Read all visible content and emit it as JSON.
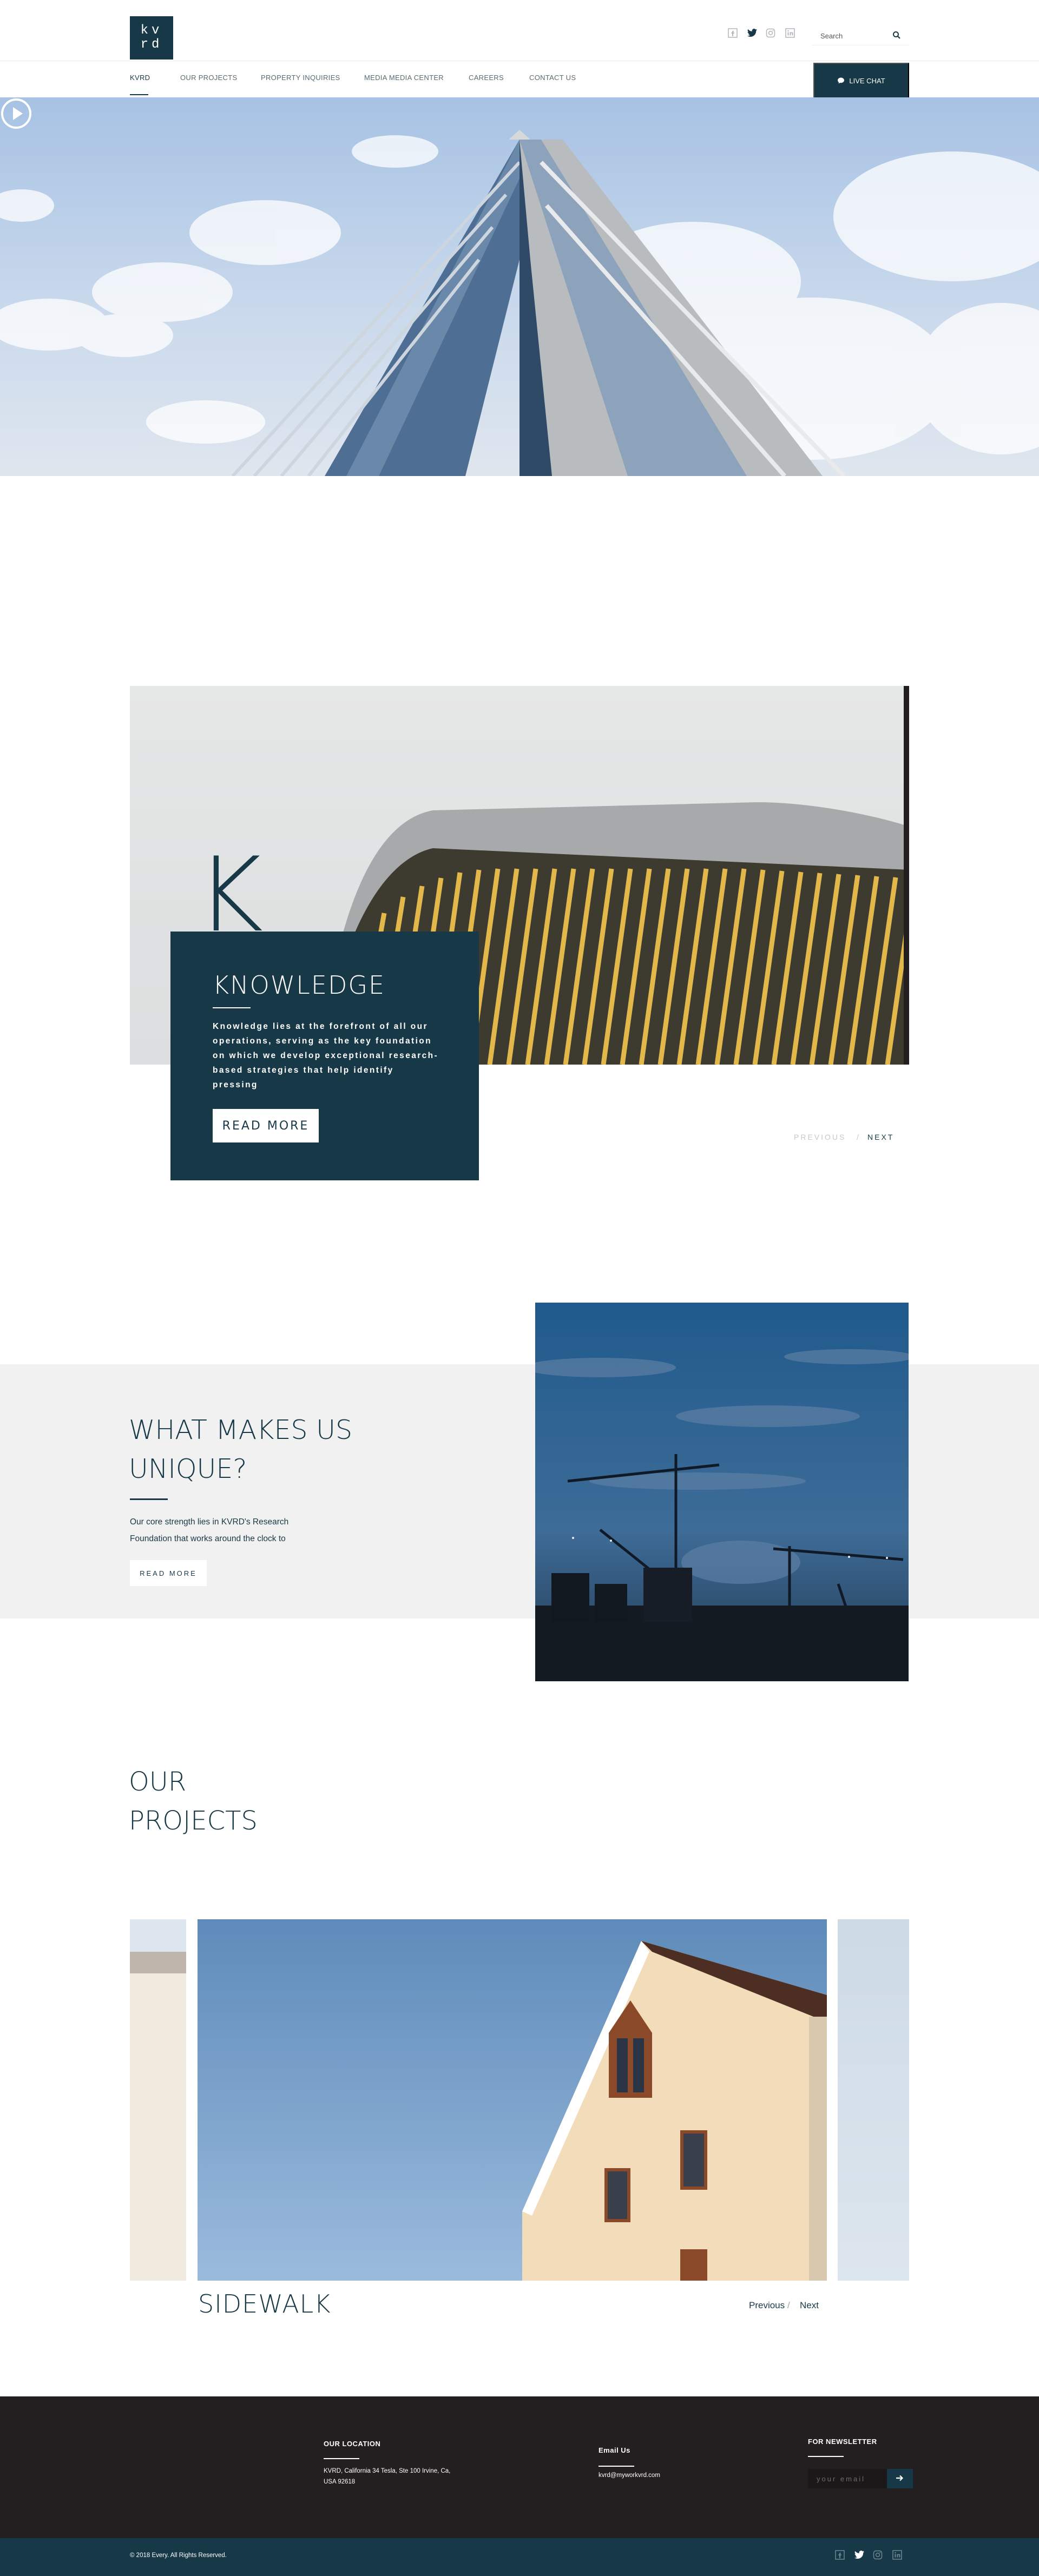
{
  "header": {
    "logo": {
      "line1": "kv",
      "line2": "rd"
    },
    "social": [
      "facebook-icon",
      "twitter-icon",
      "instagram-icon",
      "linkedin-icon"
    ],
    "search": {
      "placeholder": "Search"
    },
    "nav": [
      {
        "label": "KVRD",
        "active": true
      },
      {
        "label": "OUR PROJECTS",
        "active": false
      },
      {
        "label": "PROPERTY INQUIRIES",
        "active": false
      },
      {
        "label": "MEDIA MEDIA CENTER",
        "active": false
      },
      {
        "label": "CAREERS",
        "active": false
      },
      {
        "label": "CONTACT US",
        "active": false
      }
    ],
    "live_chat": "LIVE CHAT"
  },
  "hero": {
    "play_icon": "play-icon"
  },
  "knowledge": {
    "letter": "K",
    "title": "KNOWLEDGE",
    "body": "Knowledge lies at the forefront of all our operations, serving as the key foundation on which we develop exceptional research-based strategies that help identify pressing",
    "button": "READ MORE",
    "prev": "PREVIOUS",
    "separator": "/",
    "next": "NEXT"
  },
  "unique": {
    "title": "WHAT MAKES US UNIQUE?",
    "body": "Our core strength lies in KVRD's Research Foundation that works around the clock to",
    "button": "READ MORE"
  },
  "projects": {
    "title": "OUR PROJECTS",
    "current_name": "SIDEWALK",
    "prev": "Previous",
    "separator": "/",
    "next": "Next"
  },
  "footer": {
    "location": {
      "heading": "OUR LOCATION",
      "address": "KVRD, California 34 Tesla, Ste 100 Irvine, Ca, USA 92618"
    },
    "email": {
      "heading": "Email Us",
      "address": "kvrd@myworkvrd.com"
    },
    "newsletter": {
      "heading": "FOR NEWSLETTER",
      "placeholder": "your email"
    },
    "copyright": "© 2018 Every. All Rights Reserved.",
    "social": [
      "facebook-icon",
      "twitter-icon",
      "instagram-icon",
      "linkedin-icon"
    ]
  },
  "colors": {
    "primary": "#173847",
    "footer_bg": "#231f20",
    "band_bg": "#f1f1f1"
  }
}
